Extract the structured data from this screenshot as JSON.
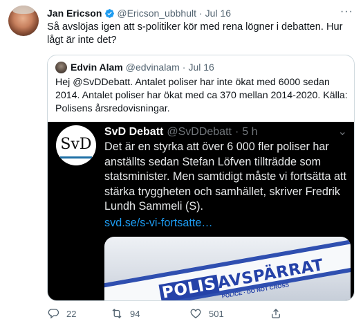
{
  "tweet": {
    "author_name": "Jan Ericson",
    "author_handle": "@Ericson_ubbhult",
    "separator": "·",
    "date": "Jul 16",
    "text": "Så avslöjas igen att s-politiker kör med rena lögner i debatten. Hur lågt är inte det?",
    "more_glyph": "···"
  },
  "quoted": {
    "author_name": "Edvin Alam",
    "author_handle": "@edvinalam",
    "separator": "·",
    "date": "Jul 16",
    "text": "Hej @SvDDebatt. Antalet poliser har inte ökat med 6000 sedan 2014. Antalet poliser har ökat med ca 370 mellan 2014-2020. Källa: Polisens årsredovisningar."
  },
  "screenshot": {
    "logo_text": "SvD",
    "author_name": "SvD Debatt",
    "author_handle": "@SvDDebatt",
    "separator": "·",
    "time": "5 h",
    "more_glyph": "⌄",
    "text": "Det är en styrka att över 6 000 fler poliser har anställts sedan Stefan Löfven tillträdde som statsminister. Men samtidigt måste vi fortsätta att stärka tryggheten och samhället, skriver Fredrik Lundh Sammeli (S).",
    "link": "svd.se/s-vi-fortsatte…",
    "tape_bold": "POLIS",
    "tape_rest": "AVSPÄRRAT",
    "tape_sub": "POLICE · DO NOT CROSS"
  },
  "actions": {
    "reply_count": "22",
    "retweet_count": "94",
    "like_count": "501",
    "icons": [
      "reply-icon",
      "retweet-icon",
      "like-icon",
      "share-icon"
    ]
  },
  "colors": {
    "accent": "#1d9bf0",
    "muted": "#536471",
    "border": "#cfd9de",
    "verified": "#1d9bf0"
  }
}
